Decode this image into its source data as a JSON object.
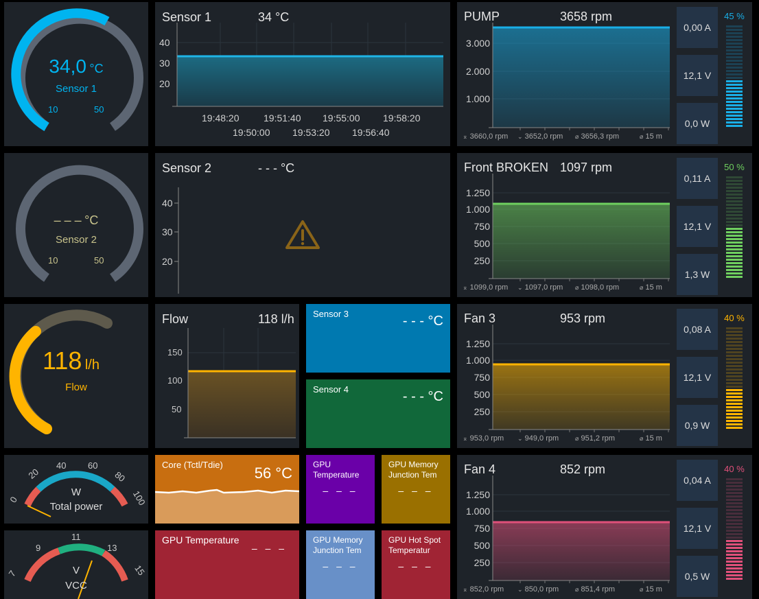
{
  "gauge1": {
    "value": "34,0",
    "unit": "°C",
    "label": "Sensor 1",
    "min": "10",
    "max": "50",
    "color": "#00b4f0",
    "frac": 0.6
  },
  "gauge2": {
    "value": "– – –",
    "unit": "°C",
    "label": "Sensor 2",
    "min": "10",
    "max": "50",
    "color": "#c8c38c"
  },
  "gauge3": {
    "value": "118",
    "unit": "l/h",
    "label": "Flow",
    "color": "#ffb400",
    "frac": 0.45
  },
  "sensor1": {
    "title": "Sensor 1",
    "value": "34 °C",
    "yticks": [
      "40",
      "30",
      "20"
    ],
    "xticks_top": [
      "19:48:20",
      "19:51:40",
      "19:55:00",
      "19:58:20"
    ],
    "xticks_bottom": [
      "19:50:00",
      "19:53:20",
      "19:56:40"
    ]
  },
  "sensor2": {
    "title": "Sensor 2",
    "value": "- - - °C",
    "yticks": [
      "40",
      "30",
      "20"
    ]
  },
  "flow": {
    "title": "Flow",
    "value": "118 l/h",
    "yticks": [
      "150",
      "100",
      "50"
    ]
  },
  "sensor3": {
    "label": "Sensor 3",
    "value": "- - - °C"
  },
  "sensor4": {
    "label": "Sensor 4",
    "value": "- - - °C"
  },
  "pump": {
    "title": "PUMP",
    "value": "3658 rpm",
    "yticks": [
      "3.000",
      "2.000",
      "1.000"
    ],
    "stats": [
      "3660,0 rpm",
      "3652,0 rpm",
      "3656,3 rpm",
      "15 m"
    ],
    "amps": "0,00 A",
    "volts": "12,1 V",
    "watts": "0,0 W",
    "percent": "45 %",
    "color": "#19aee6",
    "fill": 0.45
  },
  "front": {
    "title": "Front BROKEN",
    "value": "1097 rpm",
    "yticks": [
      "1.250",
      "1.000",
      "750",
      "500",
      "250"
    ],
    "stats": [
      "1099,0 rpm",
      "1097,0 rpm",
      "1098,0 rpm",
      "15 m"
    ],
    "amps": "0,11 A",
    "volts": "12,1 V",
    "watts": "1,3 W",
    "percent": "50 %",
    "color": "#6fcf5f",
    "fill": 0.5
  },
  "fan3": {
    "title": "Fan 3",
    "value": "953 rpm",
    "yticks": [
      "1.250",
      "1.000",
      "750",
      "500",
      "250"
    ],
    "stats": [
      "953,0 rpm",
      "949,0 rpm",
      "951,2 rpm",
      "15 m"
    ],
    "amps": "0,08 A",
    "volts": "12,1 V",
    "watts": "0,9 W",
    "percent": "40 %",
    "color": "#ffb400",
    "fill": 0.4
  },
  "fan4": {
    "title": "Fan 4",
    "value": "852 rpm",
    "yticks": [
      "1.250",
      "1.000",
      "750",
      "500",
      "250"
    ],
    "stats": [
      "852,0 rpm",
      "850,0 rpm",
      "851,4 rpm",
      "15 m"
    ],
    "amps": "0,04 A",
    "volts": "12,1 V",
    "watts": "0,5 W",
    "percent": "40 %",
    "color": "#e0507a",
    "fill": 0.4
  },
  "power": {
    "unit": "W",
    "label": "Total power",
    "ticks": [
      "0",
      "20",
      "40",
      "60",
      "80",
      "100"
    ]
  },
  "vcc": {
    "unit": "V",
    "label": "VCC",
    "ticks": [
      "7",
      "9",
      "11",
      "13",
      "15"
    ]
  },
  "core": {
    "label": "Core (Tctl/Tdie)",
    "value": "56 °C"
  },
  "gpu_temp1": {
    "label": "GPU\nTemperature",
    "value": "– – –"
  },
  "gpu_mem1": {
    "label": "GPU Memory\nJunction Tem",
    "value": "– – –"
  },
  "gpu_temp2": {
    "label": "GPU Temperature",
    "value": "– – –"
  },
  "gpu_mem2": {
    "label": "GPU Memory\nJunction Tem",
    "value": "– – –"
  },
  "gpu_hot": {
    "label": "GPU Hot Spot\nTemperatur",
    "value": "– – –"
  }
}
